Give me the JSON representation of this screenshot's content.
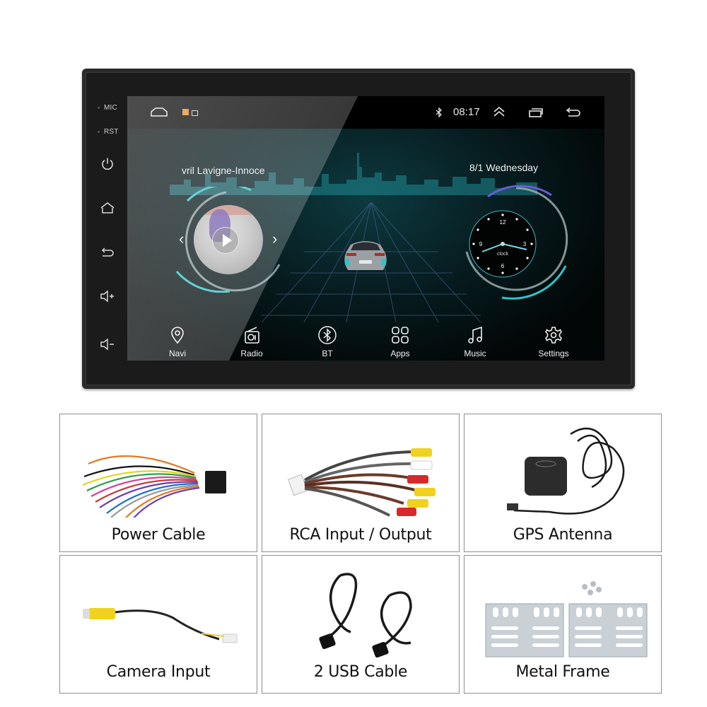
{
  "head_unit": {
    "side_labels": {
      "mic": "MIC",
      "rst": "RST"
    },
    "side_buttons": [
      "power-icon",
      "home-icon",
      "back-icon",
      "volume-up-icon",
      "volume-down-icon"
    ],
    "status_bar": {
      "left_icons": [
        "home-icon",
        "notification-app-icon",
        "notification-image-icon"
      ],
      "bluetooth_icon": "bluetooth-icon",
      "time": "08:17",
      "right_icons": [
        "expand-up-icon",
        "recent-apps-icon",
        "back-icon"
      ]
    },
    "media": {
      "song_title": "vril Lavigne-Innoce",
      "prev_glyph": "‹",
      "next_glyph": "›"
    },
    "clock_widget": {
      "date": "8/1  Wednesday",
      "label": "clock",
      "numerals": [
        "12",
        "3",
        "6",
        "9"
      ]
    },
    "dock": [
      {
        "label": "Navi",
        "icon": "location-pin-icon"
      },
      {
        "label": "Radio",
        "icon": "radio-icon"
      },
      {
        "label": "BT",
        "icon": "bluetooth-icon"
      },
      {
        "label": "Apps",
        "icon": "apps-grid-icon"
      },
      {
        "label": "Music",
        "icon": "music-note-icon"
      },
      {
        "label": "Settings",
        "icon": "gear-icon"
      }
    ],
    "colors": {
      "accent_teal": "#2ec4c9",
      "bezel": "#1b1b1b",
      "screen_bg": "#030808"
    }
  },
  "accessories": [
    {
      "caption": "Power Cable",
      "image": "power-cable-harness"
    },
    {
      "caption": "RCA Input / Output",
      "image": "rca-cable"
    },
    {
      "caption": "GPS Antenna",
      "image": "gps-antenna"
    },
    {
      "caption": "Camera Input",
      "image": "camera-input-cable"
    },
    {
      "caption": "2 USB Cable",
      "image": "usb-cables"
    },
    {
      "caption": "Metal Frame",
      "image": "metal-frame-brackets"
    }
  ]
}
